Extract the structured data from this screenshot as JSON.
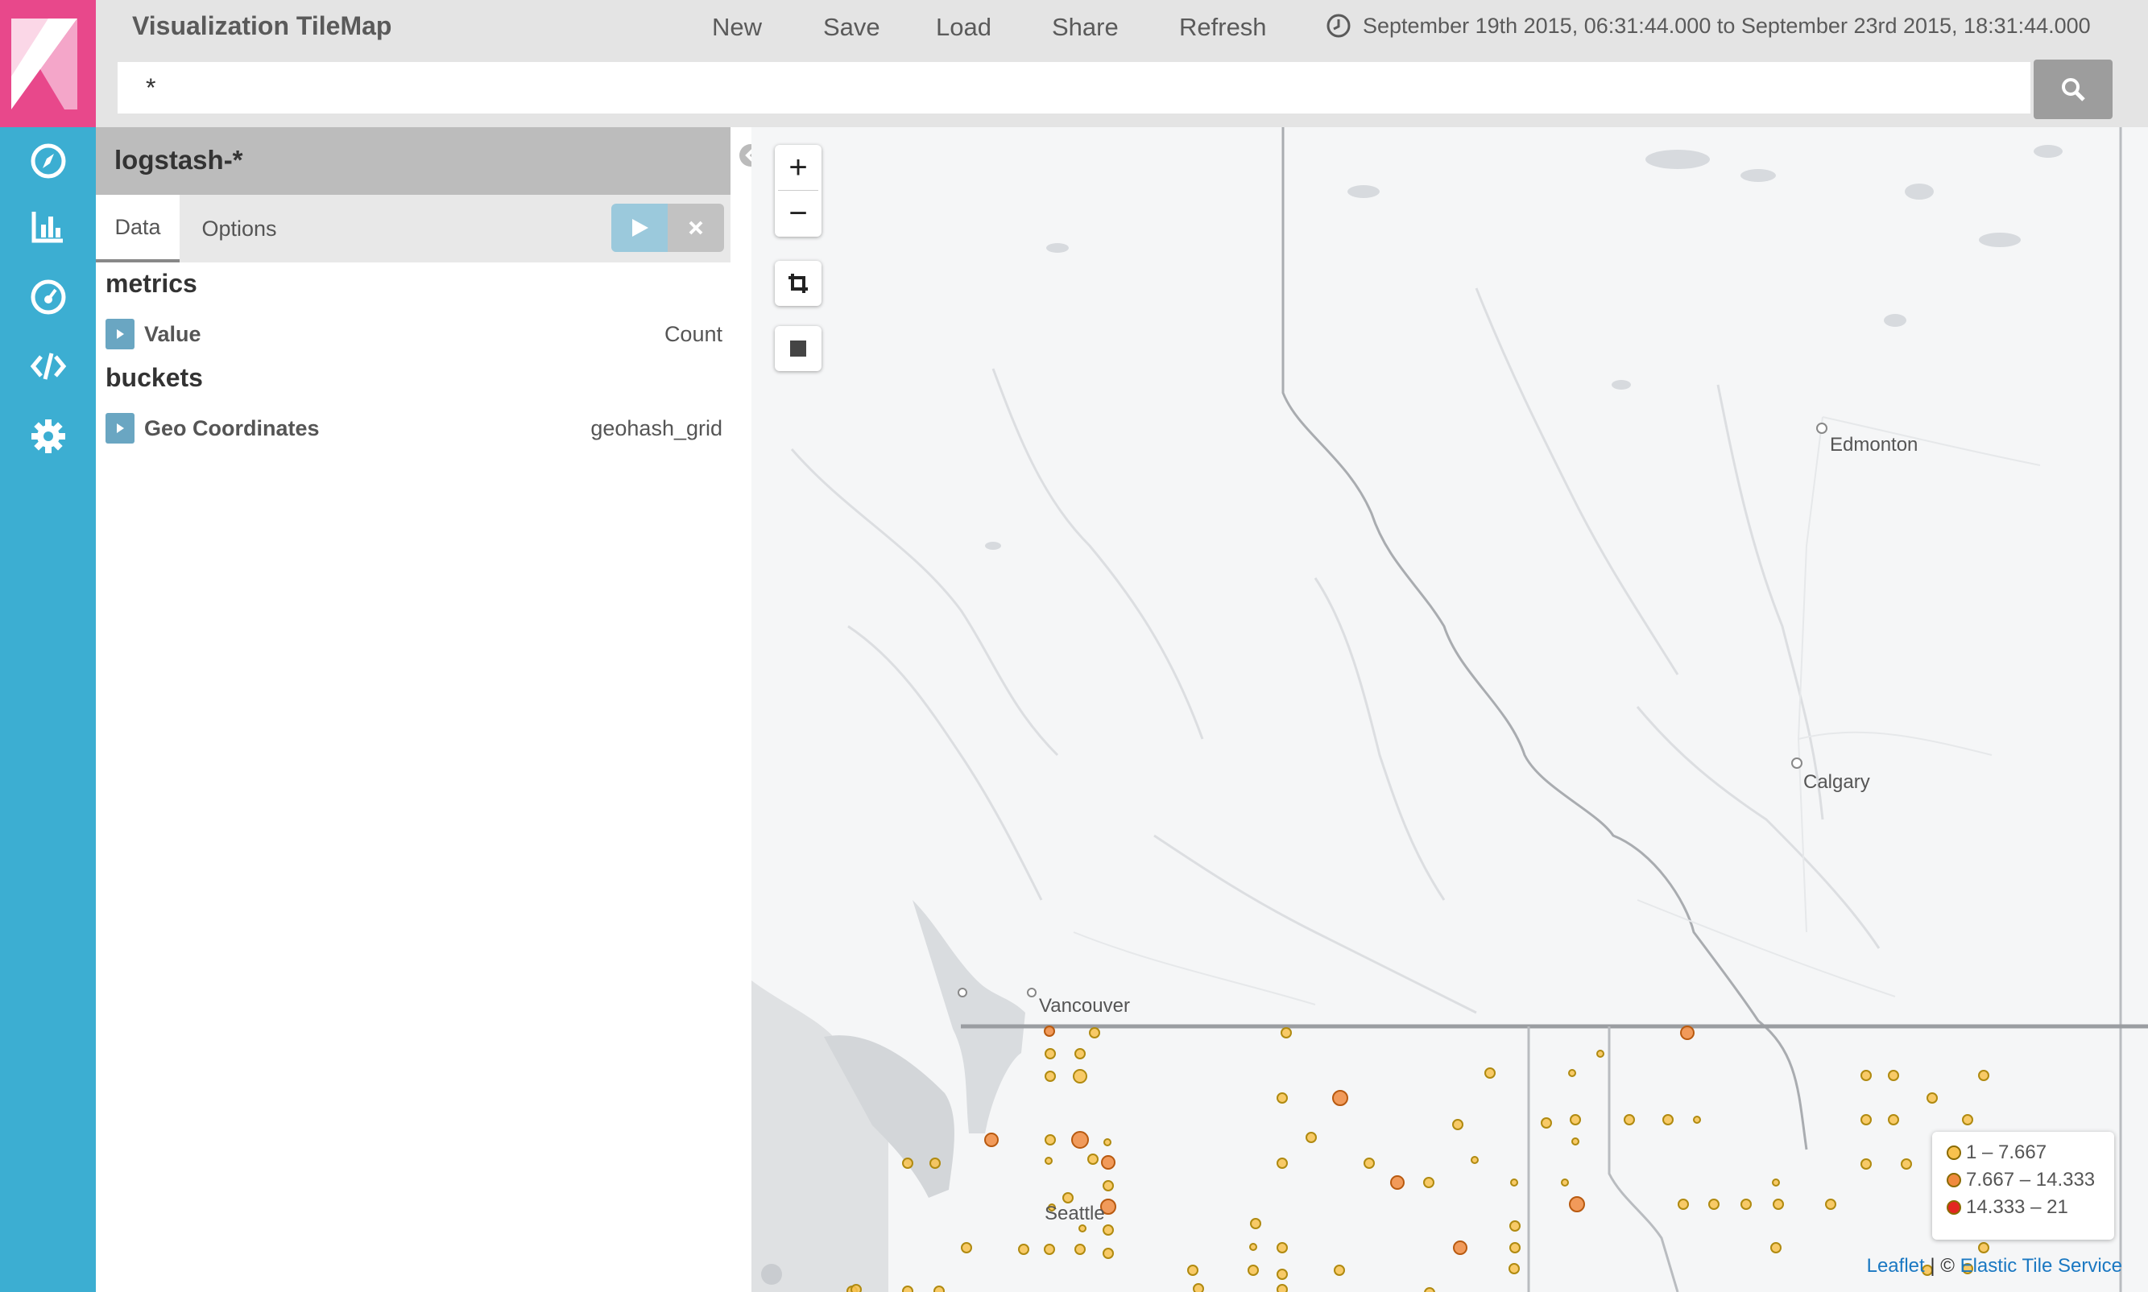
{
  "app": {
    "title": "Visualization TileMap",
    "menu": [
      "New",
      "Save",
      "Load",
      "Share",
      "Refresh"
    ],
    "time_range": "September 19th 2015, 06:31:44.000 to September 23rd 2015, 18:31:44.000"
  },
  "search": {
    "query": "*"
  },
  "sidebar": {
    "icons": [
      "discover-icon",
      "visualize-icon",
      "dashboard-icon",
      "dev-tools-icon",
      "settings-icon"
    ]
  },
  "panel": {
    "index_pattern": "logstash-*",
    "tabs": [
      "Data",
      "Options"
    ],
    "active_tab": "Data",
    "metrics_title": "metrics",
    "buckets_title": "buckets",
    "metrics": [
      {
        "label": "Value",
        "type": "Count"
      }
    ],
    "buckets": [
      {
        "label": "Geo Coordinates",
        "type": "geohash_grid"
      }
    ]
  },
  "map": {
    "cities": [
      "Edmonton",
      "Calgary",
      "Vancouver",
      "Seattle"
    ],
    "legend": [
      {
        "range": "1 – 7.667",
        "color": "#f8c24e"
      },
      {
        "range": "7.667 – 14.333",
        "color": "#f08a3e"
      },
      {
        "range": "14.333 – 21",
        "color": "#e32621"
      }
    ],
    "attribution": {
      "leaflet": "Leaflet",
      "separator": " | © ",
      "service": "Elastic Tile Service"
    },
    "colors": {
      "low": "#f8c24e",
      "mid": "#f08a3e",
      "high": "#e32621"
    }
  },
  "colors": {
    "nav": "#3caed2",
    "logo": "#e8488b",
    "topbar": "#e4e4e4"
  }
}
